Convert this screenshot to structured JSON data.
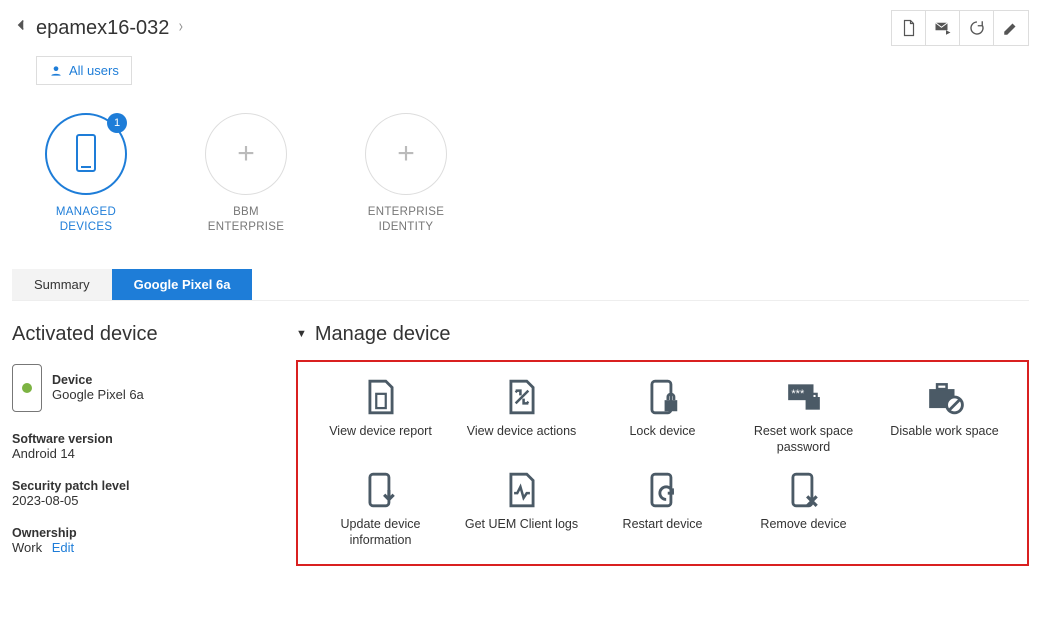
{
  "header": {
    "title": "epamex16-032"
  },
  "allUsers": {
    "label": "All users"
  },
  "categories": {
    "managed": {
      "label": "MANAGED DEVICES",
      "badge": "1"
    },
    "bbm": {
      "label": "BBM ENTERPRISE"
    },
    "identity": {
      "label": "ENTERPRISE IDENTITY"
    }
  },
  "tabs": {
    "summary": "Summary",
    "device": "Google Pixel 6a"
  },
  "activated": {
    "title": "Activated device",
    "deviceLabel": "Device",
    "deviceValue": "Google Pixel 6a",
    "softwareLabel": "Software version",
    "softwareValue": "Android 14",
    "patchLabel": "Security patch level",
    "patchValue": "2023-08-05",
    "ownershipLabel": "Ownership",
    "ownershipValue": "Work",
    "editLabel": "Edit"
  },
  "manage": {
    "title": "Manage device",
    "actions": {
      "viewReport": "View device report",
      "viewActions": "View device actions",
      "lock": "Lock device",
      "resetPwd": "Reset work space password",
      "disable": "Disable work space",
      "update": "Update device information",
      "getLogs": "Get UEM Client logs",
      "restart": "Restart device",
      "remove": "Remove device"
    }
  }
}
